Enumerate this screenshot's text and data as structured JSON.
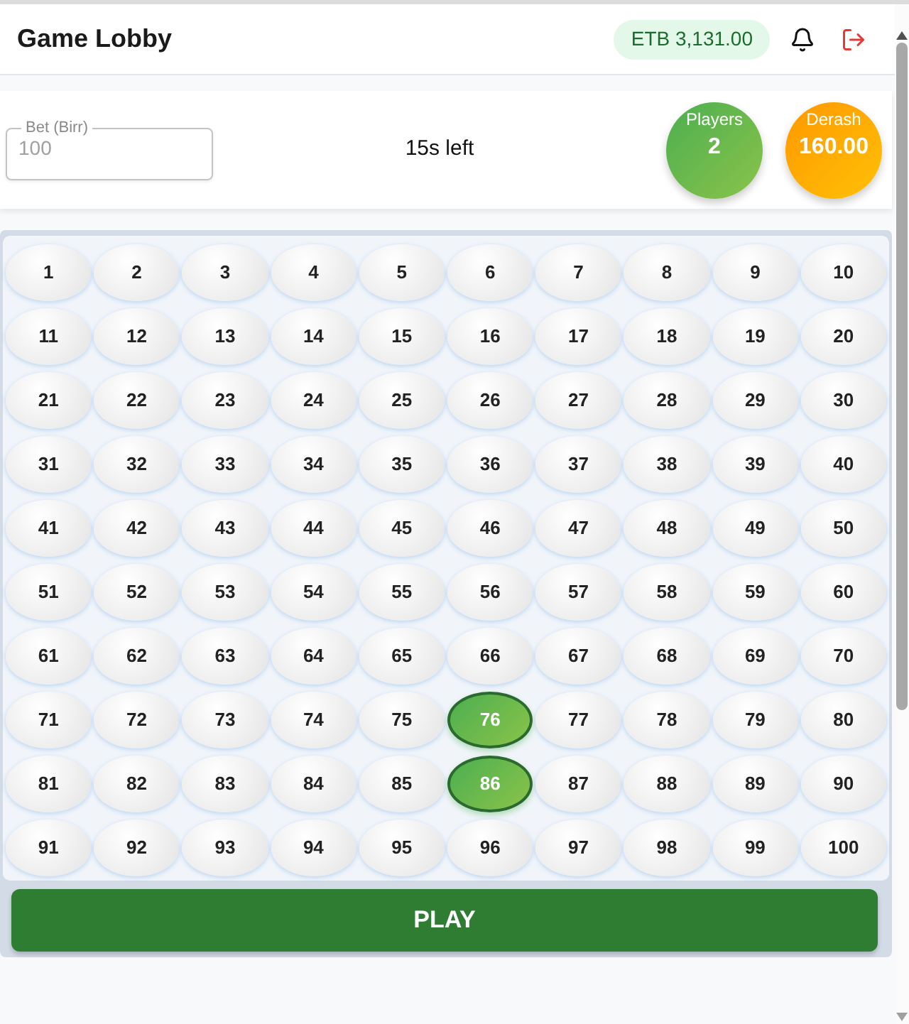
{
  "header": {
    "title": "Game Lobby",
    "balance": "ETB 3,131.00"
  },
  "bet_panel": {
    "bet_field": {
      "label": "Bet (Birr)",
      "value": "100",
      "disabled": true
    },
    "timer": "15s left",
    "stats": [
      {
        "kind": "players",
        "label": "Players",
        "value": "2"
      },
      {
        "kind": "derash",
        "label": "Derash",
        "value": "160.00"
      }
    ]
  },
  "numbers": [
    {
      "label": "1",
      "selected": false
    },
    {
      "label": "2",
      "selected": false
    },
    {
      "label": "3",
      "selected": false
    },
    {
      "label": "4",
      "selected": false
    },
    {
      "label": "5",
      "selected": false
    },
    {
      "label": "6",
      "selected": false
    },
    {
      "label": "7",
      "selected": false
    },
    {
      "label": "8",
      "selected": false
    },
    {
      "label": "9",
      "selected": false
    },
    {
      "label": "10",
      "selected": false
    },
    {
      "label": "11",
      "selected": false
    },
    {
      "label": "12",
      "selected": false
    },
    {
      "label": "13",
      "selected": false
    },
    {
      "label": "14",
      "selected": false
    },
    {
      "label": "15",
      "selected": false
    },
    {
      "label": "16",
      "selected": false
    },
    {
      "label": "17",
      "selected": false
    },
    {
      "label": "18",
      "selected": false
    },
    {
      "label": "19",
      "selected": false
    },
    {
      "label": "20",
      "selected": false
    },
    {
      "label": "21",
      "selected": false
    },
    {
      "label": "22",
      "selected": false
    },
    {
      "label": "23",
      "selected": false
    },
    {
      "label": "24",
      "selected": false
    },
    {
      "label": "25",
      "selected": false
    },
    {
      "label": "26",
      "selected": false
    },
    {
      "label": "27",
      "selected": false
    },
    {
      "label": "28",
      "selected": false
    },
    {
      "label": "29",
      "selected": false
    },
    {
      "label": "30",
      "selected": false
    },
    {
      "label": "31",
      "selected": false
    },
    {
      "label": "32",
      "selected": false
    },
    {
      "label": "33",
      "selected": false
    },
    {
      "label": "34",
      "selected": false
    },
    {
      "label": "35",
      "selected": false
    },
    {
      "label": "36",
      "selected": false
    },
    {
      "label": "37",
      "selected": false
    },
    {
      "label": "38",
      "selected": false
    },
    {
      "label": "39",
      "selected": false
    },
    {
      "label": "40",
      "selected": false
    },
    {
      "label": "41",
      "selected": false
    },
    {
      "label": "42",
      "selected": false
    },
    {
      "label": "43",
      "selected": false
    },
    {
      "label": "44",
      "selected": false
    },
    {
      "label": "45",
      "selected": false
    },
    {
      "label": "46",
      "selected": false
    },
    {
      "label": "47",
      "selected": false
    },
    {
      "label": "48",
      "selected": false
    },
    {
      "label": "49",
      "selected": false
    },
    {
      "label": "50",
      "selected": false
    },
    {
      "label": "51",
      "selected": false
    },
    {
      "label": "52",
      "selected": false
    },
    {
      "label": "53",
      "selected": false
    },
    {
      "label": "54",
      "selected": false
    },
    {
      "label": "55",
      "selected": false
    },
    {
      "label": "56",
      "selected": false
    },
    {
      "label": "57",
      "selected": false
    },
    {
      "label": "58",
      "selected": false
    },
    {
      "label": "59",
      "selected": false
    },
    {
      "label": "60",
      "selected": false
    },
    {
      "label": "61",
      "selected": false
    },
    {
      "label": "62",
      "selected": false
    },
    {
      "label": "63",
      "selected": false
    },
    {
      "label": "64",
      "selected": false
    },
    {
      "label": "65",
      "selected": false
    },
    {
      "label": "66",
      "selected": false
    },
    {
      "label": "67",
      "selected": false
    },
    {
      "label": "68",
      "selected": false
    },
    {
      "label": "69",
      "selected": false
    },
    {
      "label": "70",
      "selected": false
    },
    {
      "label": "71",
      "selected": false
    },
    {
      "label": "72",
      "selected": false
    },
    {
      "label": "73",
      "selected": false
    },
    {
      "label": "74",
      "selected": false
    },
    {
      "label": "75",
      "selected": false
    },
    {
      "label": "76",
      "selected": true
    },
    {
      "label": "77",
      "selected": false
    },
    {
      "label": "78",
      "selected": false
    },
    {
      "label": "79",
      "selected": false
    },
    {
      "label": "80",
      "selected": false
    },
    {
      "label": "81",
      "selected": false
    },
    {
      "label": "82",
      "selected": false
    },
    {
      "label": "83",
      "selected": false
    },
    {
      "label": "84",
      "selected": false
    },
    {
      "label": "85",
      "selected": false
    },
    {
      "label": "86",
      "selected": true
    },
    {
      "label": "87",
      "selected": false
    },
    {
      "label": "88",
      "selected": false
    },
    {
      "label": "89",
      "selected": false
    },
    {
      "label": "90",
      "selected": false
    },
    {
      "label": "91",
      "selected": false
    },
    {
      "label": "92",
      "selected": false
    },
    {
      "label": "93",
      "selected": false
    },
    {
      "label": "94",
      "selected": false
    },
    {
      "label": "95",
      "selected": false
    },
    {
      "label": "96",
      "selected": false
    },
    {
      "label": "97",
      "selected": false
    },
    {
      "label": "98",
      "selected": false
    },
    {
      "label": "99",
      "selected": false
    },
    {
      "label": "100",
      "selected": false
    }
  ],
  "play_button": "PLAY"
}
